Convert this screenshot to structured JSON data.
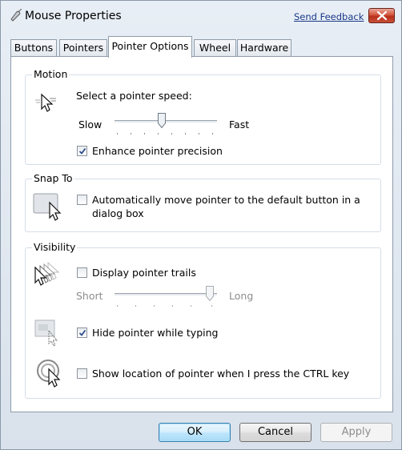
{
  "window": {
    "title": "Mouse Properties",
    "send_feedback": "Send Feedback",
    "close_icon": "close-icon"
  },
  "tabs": [
    {
      "label": "Buttons",
      "active": false
    },
    {
      "label": "Pointers",
      "active": false
    },
    {
      "label": "Pointer Options",
      "active": true
    },
    {
      "label": "Wheel",
      "active": false
    },
    {
      "label": "Hardware",
      "active": false
    }
  ],
  "motion": {
    "title": "Motion",
    "prompt": "Select a pointer speed:",
    "slow_label": "Slow",
    "fast_label": "Fast",
    "speed_fraction": 0.5,
    "enhance_label": "Enhance pointer precision",
    "enhance_checked": true
  },
  "snap_to": {
    "title": "Snap To",
    "label_line1": "Automatically move pointer to the default button in a",
    "label_line2": "dialog box",
    "checked": false
  },
  "visibility": {
    "title": "Visibility",
    "trails_label": "Display pointer trails",
    "trails_checked": false,
    "short_label": "Short",
    "long_label": "Long",
    "trails_fraction": 1.0,
    "hide_label": "Hide pointer while typing",
    "hide_checked": true,
    "show_location_label": "Show location of pointer when I press the CTRL key",
    "show_location_checked": false
  },
  "buttons": {
    "ok": "OK",
    "cancel": "Cancel",
    "apply": "Apply"
  },
  "colors": {
    "accent": "#3c7fb1",
    "close": "#c8503a",
    "disabled_text": "#8d8d8d"
  }
}
